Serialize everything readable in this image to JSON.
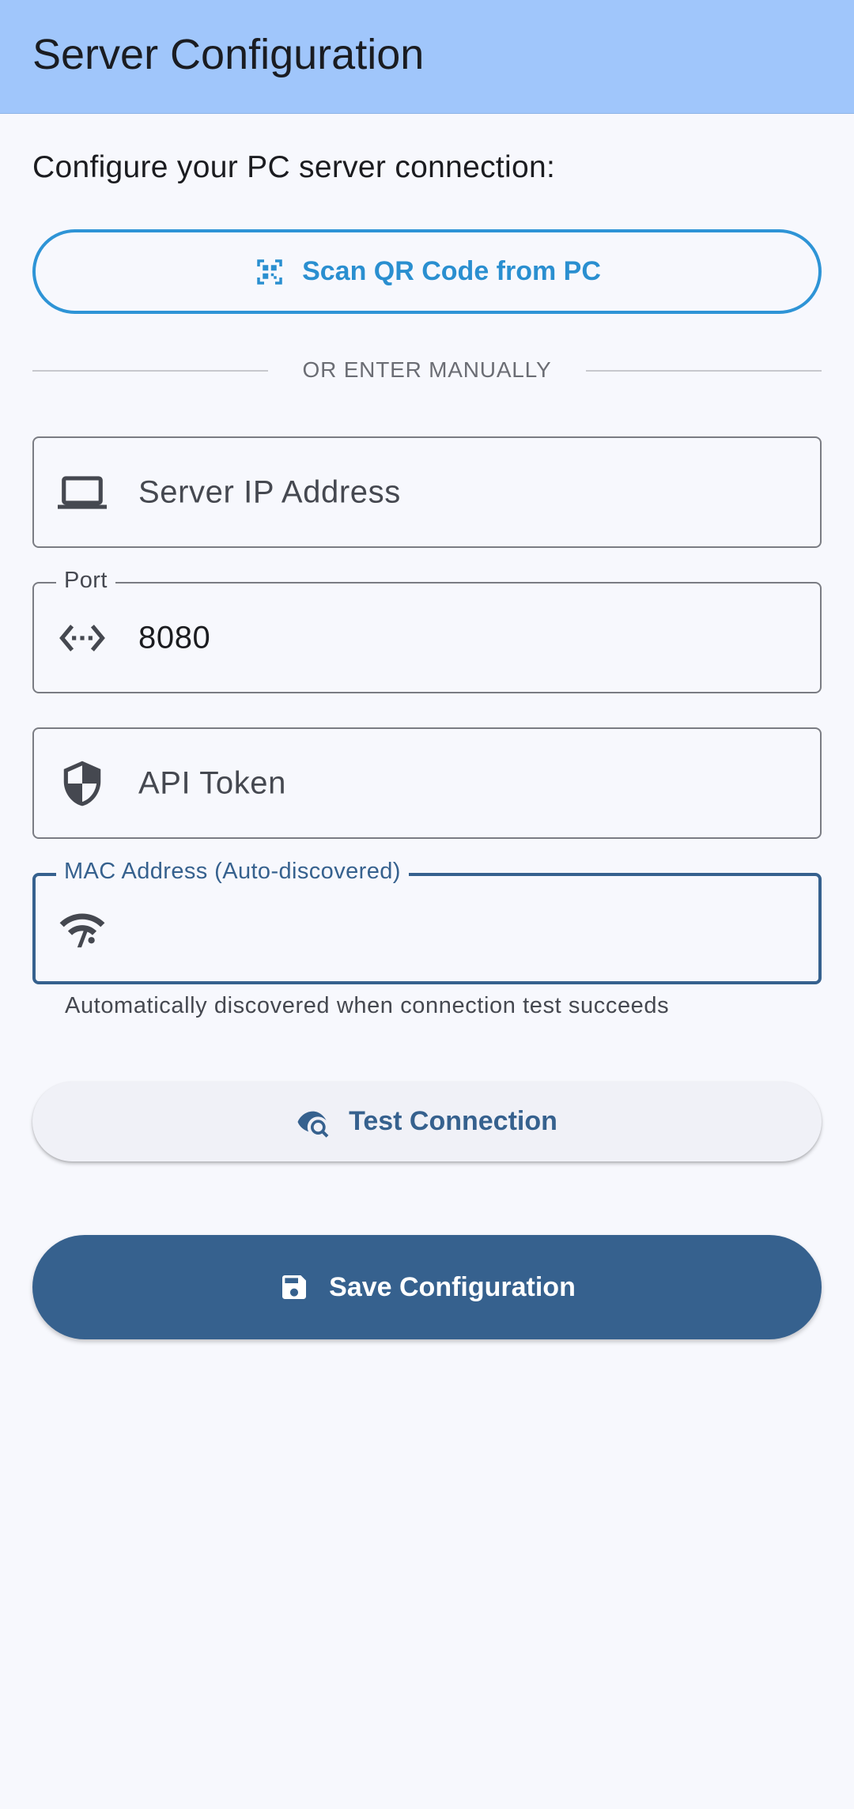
{
  "appbar": {
    "title": "Server Configuration"
  },
  "form": {
    "subtitle": "Configure your PC server connection:",
    "scan_button": {
      "label": "Scan QR Code from PC",
      "icon": "qr-code-scanner-icon"
    },
    "divider_text": "OR ENTER MANUALLY",
    "server_ip": {
      "placeholder": "Server IP Address",
      "value": "",
      "icon": "laptop-icon"
    },
    "port": {
      "label": "Port",
      "value": "8080",
      "icon": "settings-ethernet-icon"
    },
    "api_token": {
      "placeholder": "API Token",
      "value": "",
      "icon": "shield-icon"
    },
    "mac_address": {
      "label": "MAC Address (Auto-discovered)",
      "value": "",
      "helper": "Automatically discovered when connection test succeeds",
      "icon": "wifi-find-icon"
    },
    "test_button": {
      "label": "Test Connection",
      "icon": "eye-search-icon"
    },
    "save_button": {
      "label": "Save Configuration",
      "icon": "save-icon"
    }
  },
  "colors": {
    "appbar": "#a0c6fb",
    "background": "#f7f8fd",
    "primary": "#36618e",
    "scan_accent": "#2e94d6"
  }
}
